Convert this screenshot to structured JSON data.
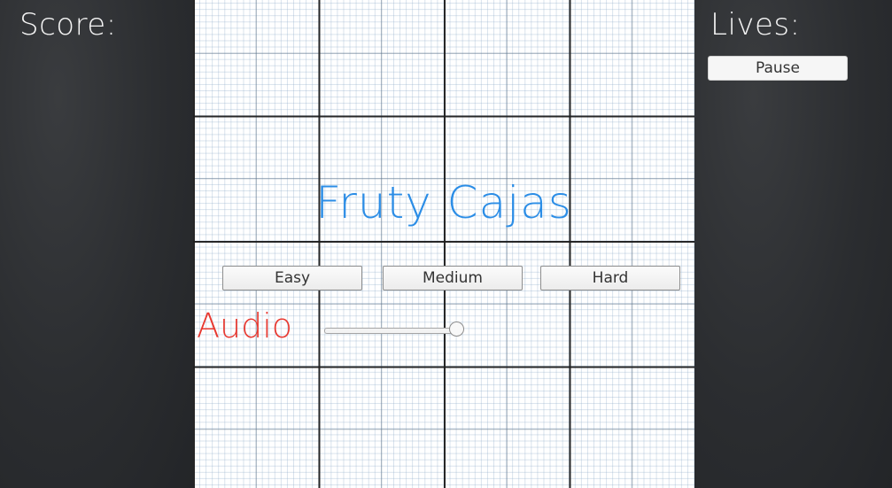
{
  "hud": {
    "score_label": "Score:",
    "lives_label": "Lives:",
    "pause_label": "Pause"
  },
  "menu": {
    "title": "Fruty Cajas",
    "difficulty_buttons": [
      "Easy",
      "Medium",
      "Hard"
    ],
    "audio_label": "Audio",
    "audio_volume": 1.0
  },
  "colors": {
    "title": "#2b8de6",
    "audio_label": "#e8382f",
    "side_panel": "#2b2d30"
  }
}
